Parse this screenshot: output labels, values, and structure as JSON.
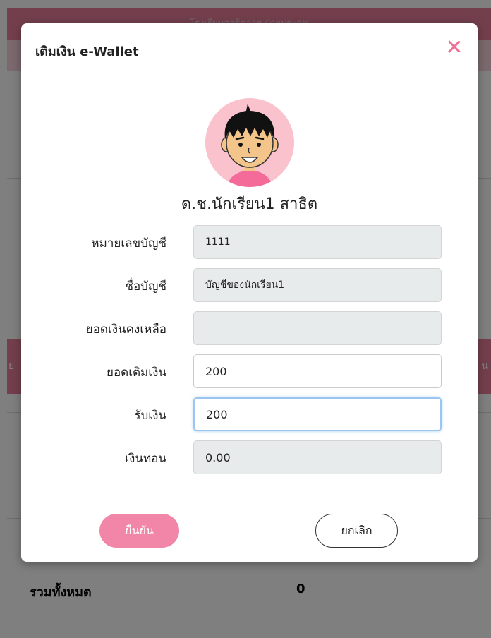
{
  "background": {
    "header_text": "โรงเรียนสาธิตวาย ฝ่ายประถม",
    "bar_left_fragment": "ย",
    "bar_right_fragment": "น",
    "total_label": "รวมทั้งหมด",
    "total_value": "0"
  },
  "modal": {
    "title": "เติมเงิน e-Wallet",
    "close_symbol": "✕",
    "student_name": "ด.ช.นักเรียน1 สาธิต",
    "fields": {
      "account_number": {
        "label": "หมายเลขบัญชี",
        "value": "1111"
      },
      "account_name": {
        "label": "ชื่อบัญชี",
        "value": "บัญชีของนักเรียน1"
      },
      "balance": {
        "label": "ยอดเงินคงเหลือ",
        "value": ""
      },
      "topup_amount": {
        "label": "ยอดเติมเงิน",
        "value": "200"
      },
      "received": {
        "label": "รับเงิน",
        "value": "200"
      },
      "change": {
        "label": "เงินทอน",
        "value": "0.00"
      }
    },
    "confirm_label": "ยืนยัน",
    "cancel_label": "ยกเลิก"
  },
  "colors": {
    "accent_pink": "#f186a8",
    "close_pink": "#ef6f95",
    "header_pink": "#e87f9b"
  },
  "icons": {
    "close": "close-icon",
    "avatar": "student-avatar"
  }
}
